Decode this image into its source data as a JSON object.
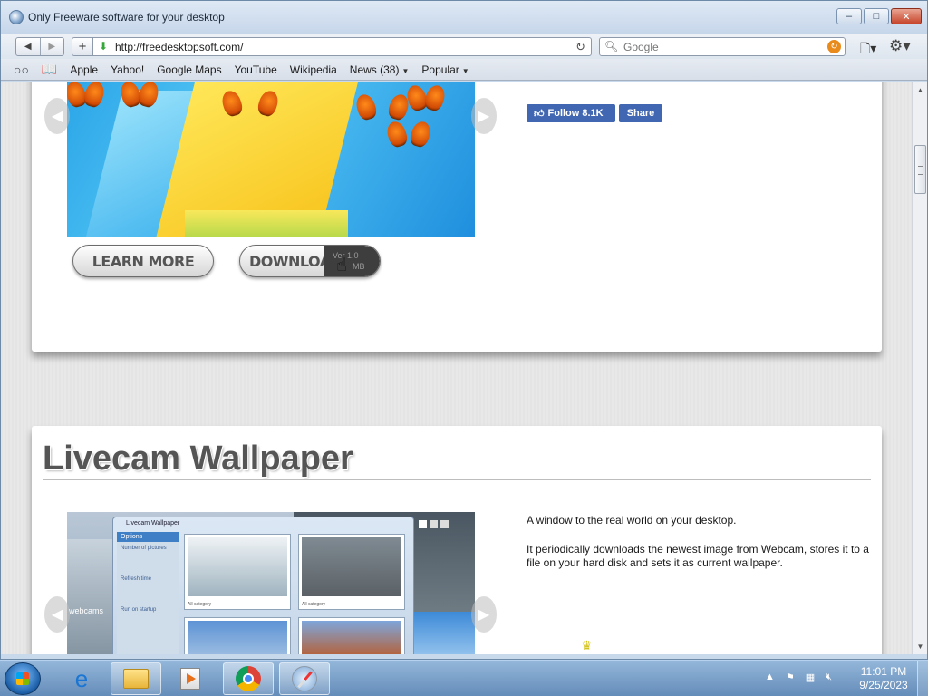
{
  "window": {
    "title": "Only Freeware software for your desktop",
    "controls": {
      "minimize": "–",
      "maximize": "□",
      "close": "✕"
    }
  },
  "toolbar": {
    "back_icon": "◀",
    "forward_icon": "▶",
    "add_icon": "+",
    "url": "http://freedesktopsoft.com/",
    "reload_icon": "↻",
    "search_placeholder": "Google",
    "search_go_icon": "↻",
    "page_menu_icon": "🗋▾",
    "gear_menu_icon": "⚙▾"
  },
  "bookmarks": {
    "reader_icon": "○○",
    "book_icon": "📖",
    "items": [
      {
        "label": "Apple"
      },
      {
        "label": "Yahoo!"
      },
      {
        "label": "Google Maps"
      },
      {
        "label": "YouTube"
      },
      {
        "label": "Wikipedia"
      },
      {
        "label": "News (38)",
        "menu": true
      },
      {
        "label": "Popular",
        "menu": true
      }
    ]
  },
  "product1": {
    "learn_more": "LEARN MORE",
    "download": "DOWNLOAD ME",
    "version": "Ver 1.0",
    "size": "MB",
    "facebook": {
      "follow": "Follow 8.1K",
      "share": "Share"
    }
  },
  "product2": {
    "title": "Livecam Wallpaper",
    "description_1": "A window to the real world on your desktop.",
    "description_2": "It periodically downloads the newest image from Webcam, stores it to a file on your hard disk and sets it as current wallpaper.",
    "screenshot": {
      "app_title": "Livecam Wallpaper",
      "side_header": "Options",
      "side_labels": [
        "Number of pictures",
        "Refresh time",
        "Run on startup"
      ],
      "captions": [
        "All category",
        "All category"
      ],
      "watermark": "webcams"
    }
  },
  "taskbar": {
    "time": "11:01 PM",
    "date": "9/25/2023"
  },
  "colors": {
    "facebook": "#4267b2",
    "title_text": "#555555",
    "taskbar": "#7fa3c9"
  }
}
